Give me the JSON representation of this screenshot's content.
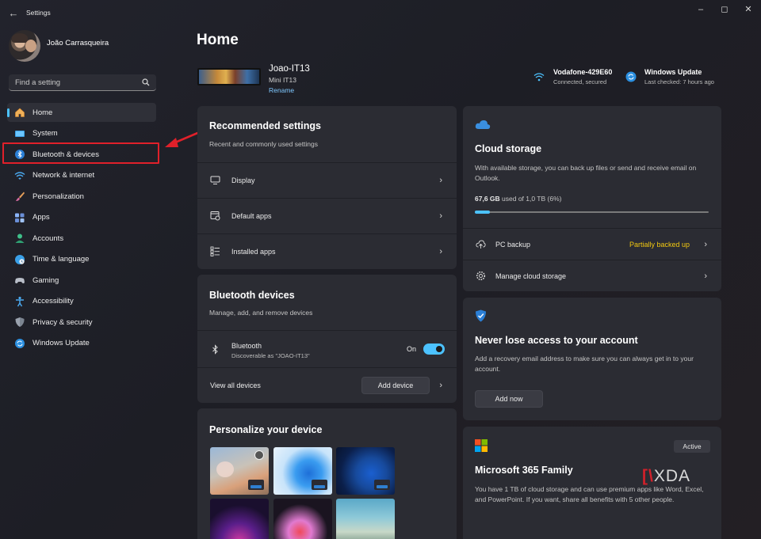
{
  "window": {
    "title": "Settings"
  },
  "user": {
    "name": "João Carrasqueira"
  },
  "search": {
    "placeholder": "Find a setting"
  },
  "sidebar": {
    "items": [
      {
        "label": "Home",
        "icon": "home-icon"
      },
      {
        "label": "System",
        "icon": "system-icon"
      },
      {
        "label": "Bluetooth & devices",
        "icon": "bluetooth-icon"
      },
      {
        "label": "Network & internet",
        "icon": "wifi-icon"
      },
      {
        "label": "Personalization",
        "icon": "brush-icon"
      },
      {
        "label": "Apps",
        "icon": "apps-icon"
      },
      {
        "label": "Accounts",
        "icon": "accounts-icon"
      },
      {
        "label": "Time & language",
        "icon": "globe-clock-icon"
      },
      {
        "label": "Gaming",
        "icon": "gamepad-icon"
      },
      {
        "label": "Accessibility",
        "icon": "accessibility-icon"
      },
      {
        "label": "Privacy & security",
        "icon": "shield-icon"
      },
      {
        "label": "Windows Update",
        "icon": "update-icon"
      }
    ],
    "active_index": 0
  },
  "page": {
    "title": "Home"
  },
  "device": {
    "name": "Joao-IT13",
    "model": "Mini IT13",
    "rename_label": "Rename"
  },
  "network": {
    "name": "Vodafone-429E60",
    "status": "Connected, secured"
  },
  "update": {
    "title": "Windows Update",
    "status": "Last checked: 7 hours ago"
  },
  "recommended": {
    "title": "Recommended settings",
    "subtitle": "Recent and commonly used settings",
    "rows": [
      {
        "label": "Display",
        "icon": "monitor-icon"
      },
      {
        "label": "Default apps",
        "icon": "default-apps-icon"
      },
      {
        "label": "Installed apps",
        "icon": "installed-apps-icon"
      }
    ]
  },
  "bluetooth": {
    "title": "Bluetooth devices",
    "subtitle": "Manage, add, and remove devices",
    "row_label": "Bluetooth",
    "row_sub": "Discoverable as \"JOAO-IT13\"",
    "toggle_label": "On",
    "toggle_on": true,
    "view_all_label": "View all devices",
    "add_device_label": "Add device"
  },
  "personalize": {
    "title": "Personalize your device"
  },
  "cloud": {
    "title": "Cloud storage",
    "subtitle": "With available storage, you can back up files or send and receive email on Outlook.",
    "used": "67,6 GB",
    "used_detail": "used of 1,0 TB (6%)",
    "used_fraction": 0.066,
    "backup_label": "PC backup",
    "backup_status": "Partially backed up",
    "manage_label": "Manage cloud storage"
  },
  "account": {
    "title": "Never lose access to your account",
    "subtitle": "Add a recovery email address to make sure you can always get in to your account.",
    "button_label": "Add now"
  },
  "m365": {
    "title": "Microsoft 365 Family",
    "badge": "Active",
    "subtitle": "You have 1 TB of cloud storage and can use premium apps like Word, Excel, and PowerPoint. If you want, share all benefits with 5 other people."
  },
  "watermark": "XDA",
  "colors": {
    "accent": "#4cc2ff",
    "warning": "#f2c811",
    "annotation": "#e0202a"
  }
}
